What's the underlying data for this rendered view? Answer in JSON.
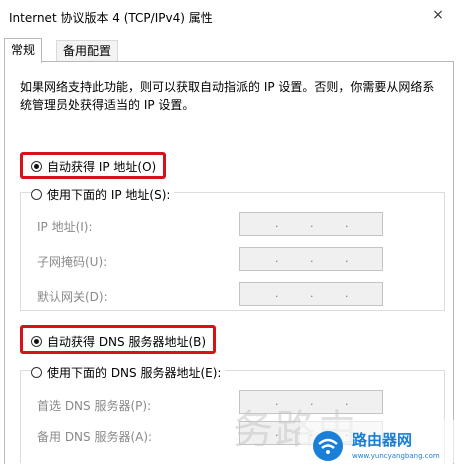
{
  "window": {
    "title": "Internet 协议版本 4 (TCP/IPv4) 属性",
    "close_glyph": "×"
  },
  "tabs": [
    {
      "label": "常规"
    },
    {
      "label": "备用配置"
    }
  ],
  "description": "如果网络支持此功能，则可以获取自动指派的 IP 设置。否则，你需要从网络系统管理员处获得适当的 IP 设置。",
  "ip": {
    "auto_label": "自动获得 IP 地址(O)",
    "auto_selected": true,
    "manual_label": "使用下面的 IP 地址(S):",
    "manual_selected": false,
    "fields": [
      {
        "label": "IP 地址(I):"
      },
      {
        "label": "子网掩码(U):"
      },
      {
        "label": "默认网关(D):"
      }
    ]
  },
  "dns": {
    "auto_label": "自动获得 DNS 服务器地址(B)",
    "auto_selected": true,
    "manual_label": "使用下面的 DNS 服务器地址(E):",
    "manual_selected": false,
    "fields": [
      {
        "label": "首选 DNS 服务器(P):"
      },
      {
        "label": "备用 DNS 服务器(A):"
      }
    ]
  },
  "ip_separator": ".",
  "watermark": {
    "text": "务路由",
    "site": "www.yuncyangbang.com",
    "brand": "路由器网"
  },
  "colors": {
    "highlight_box": "#d8101a",
    "accent": "#1a7fd6",
    "disabled_text": "#8a8a8a"
  }
}
